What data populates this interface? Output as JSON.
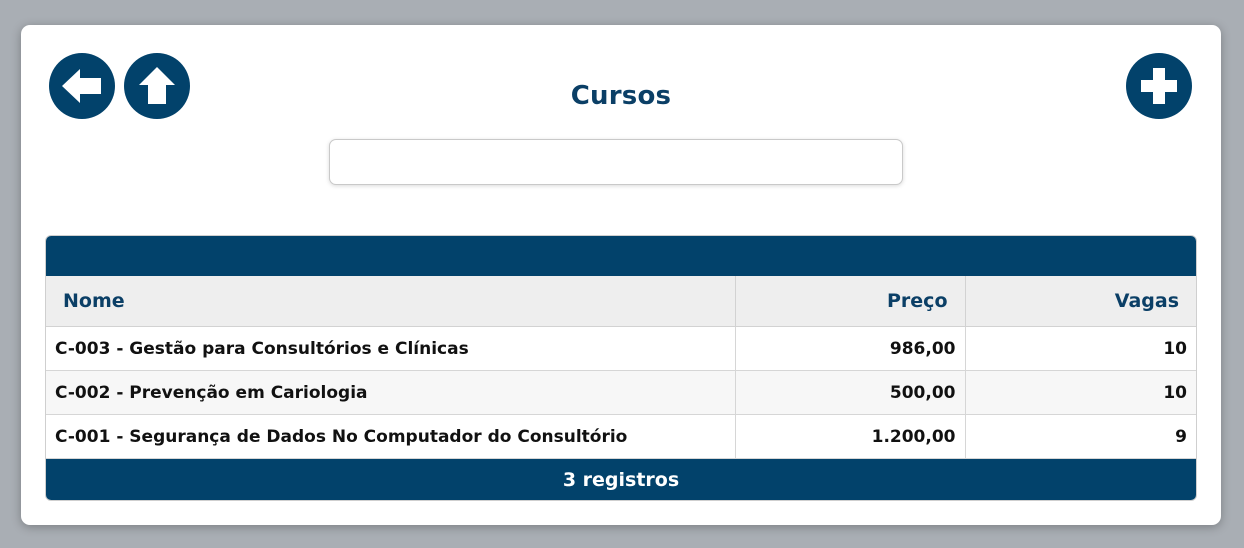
{
  "header": {
    "title": "Cursos",
    "back_icon": "arrow-left-icon",
    "home_icon": "arrow-up-icon",
    "add_icon": "plus-icon"
  },
  "search": {
    "value": "",
    "placeholder": ""
  },
  "table": {
    "columns": [
      "Nome",
      "Preço",
      "Vagas"
    ],
    "rows": [
      {
        "nome": "C-003 - Gestão para Consultórios e Clínicas",
        "preco": "986,00",
        "vagas": "10"
      },
      {
        "nome": "C-002 - Prevenção em Cariologia",
        "preco": "500,00",
        "vagas": "10"
      },
      {
        "nome": "C-001 - Segurança de Dados No Computador do Consultório",
        "preco": "1.200,00",
        "vagas": "9"
      }
    ],
    "footer": "3 registros"
  },
  "colors": {
    "primary": "#02426b",
    "title": "#0b3f66",
    "header_bg": "#eeeeee"
  }
}
